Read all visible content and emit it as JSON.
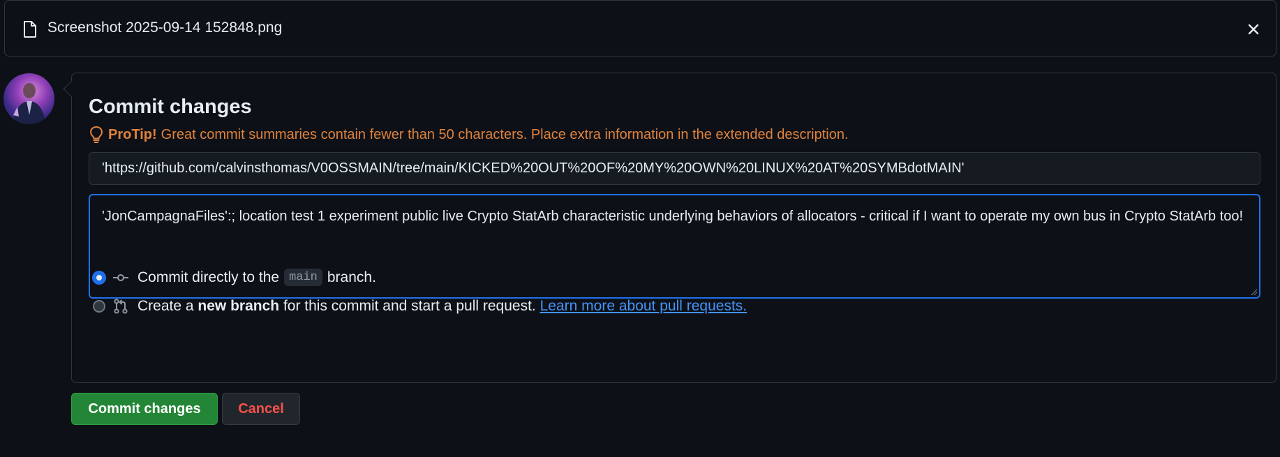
{
  "file_bar": {
    "file_name": "Screenshot 2025-09-14 152848.png"
  },
  "commit": {
    "title": "Commit changes",
    "protip_label": "ProTip!",
    "protip_text": "Great commit summaries contain fewer than 50 characters. Place extra information in the extended description.",
    "summary_value": "'https://github.com/calvinsthomas/V0OSSMAIN/tree/main/KICKED%20OUT%20OF%20MY%20OWN%20LINUX%20AT%20SYMBdotMAIN'",
    "description_value": "'JonCampagnaFiles':; location test 1 experiment public live Crypto StatArb characteristic underlying behaviors of allocators - critical if I want to operate my own bus in Crypto StatArb too!",
    "option_direct": {
      "text_before": "Commit directly to the",
      "branch": "main",
      "text_after": "branch.",
      "selected": true
    },
    "option_new_branch": {
      "text_before": "Create a",
      "bold": "new branch",
      "text_after": "for this commit and start a pull request.",
      "link": "Learn more about pull requests.",
      "selected": false
    }
  },
  "buttons": {
    "commit_label": "Commit changes",
    "cancel_label": "Cancel"
  },
  "colors": {
    "accent_blue": "#1f6feb",
    "protip_orange": "#e0823d",
    "commit_green": "#238636",
    "cancel_red": "#f85149",
    "link_blue": "#4493f8"
  },
  "icons": [
    "file-icon",
    "close-icon",
    "lightbulb-icon",
    "git-commit-icon",
    "git-pull-request-icon"
  ]
}
